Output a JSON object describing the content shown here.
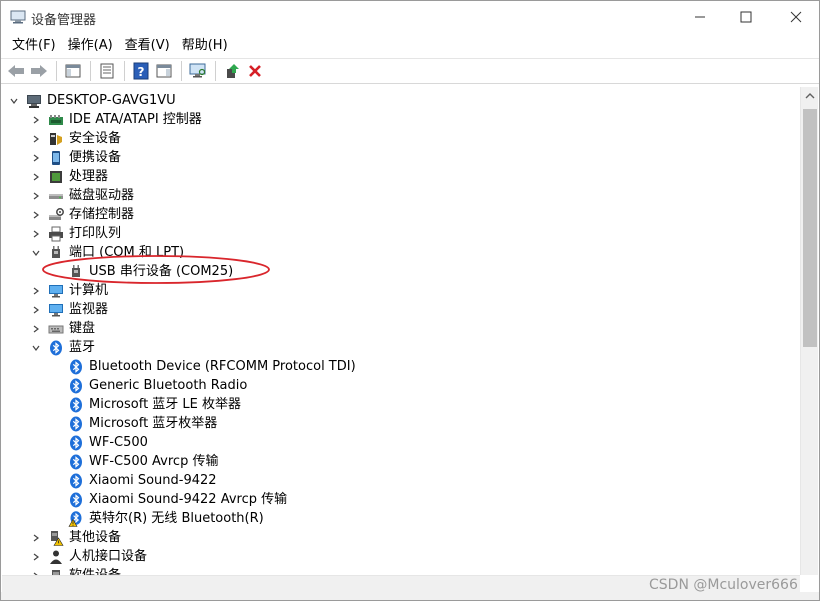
{
  "window": {
    "title": "设备管理器",
    "controls": {
      "minimize": "minimize-icon",
      "maximize": "maximize-icon",
      "close": "close-icon"
    }
  },
  "menu": [
    "文件(F)",
    "操作(A)",
    "查看(V)",
    "帮助(H)"
  ],
  "toolbar": {
    "icons": [
      "back-arrow-icon",
      "forward-arrow-icon",
      "show-hide-console-tree-icon",
      "properties-icon",
      "help-icon",
      "action-pane-icon",
      "scan-hardware-icon",
      "update-driver-icon",
      "uninstall-device-icon"
    ]
  },
  "tree": {
    "root": "DESKTOP-GAVG1VU",
    "categories_top": [
      {
        "label": "IDE ATA/ATAPI 控制器",
        "icon": "ide-controller-icon"
      },
      {
        "label": "安全设备",
        "icon": "security-device-icon"
      },
      {
        "label": "便携设备",
        "icon": "portable-device-icon"
      },
      {
        "label": "处理器",
        "icon": "processor-icon"
      },
      {
        "label": "磁盘驱动器",
        "icon": "disk-drive-icon"
      },
      {
        "label": "存储控制器",
        "icon": "storage-controller-icon"
      },
      {
        "label": "打印队列",
        "icon": "print-queue-icon"
      }
    ],
    "ports": {
      "label": "端口 (COM 和 LPT)",
      "children": [
        "USB 串行设备 (COM25)"
      ]
    },
    "categories_mid": [
      {
        "label": "计算机",
        "icon": "computer-icon"
      },
      {
        "label": "监视器",
        "icon": "monitor-icon"
      },
      {
        "label": "键盘",
        "icon": "keyboard-icon"
      }
    ],
    "bluetooth": {
      "label": "蓝牙",
      "children": [
        {
          "label": "Bluetooth Device (RFCOMM Protocol TDI)",
          "warning": false
        },
        {
          "label": "Generic Bluetooth Radio",
          "warning": false
        },
        {
          "label": "Microsoft 蓝牙 LE 枚举器",
          "warning": false
        },
        {
          "label": "Microsoft 蓝牙枚举器",
          "warning": false
        },
        {
          "label": "WF-C500",
          "warning": false
        },
        {
          "label": "WF-C500 Avrcp 传输",
          "warning": false
        },
        {
          "label": "Xiaomi Sound-9422",
          "warning": false
        },
        {
          "label": "Xiaomi Sound-9422 Avrcp 传输",
          "warning": false
        },
        {
          "label": "英特尔(R) 无线 Bluetooth(R)",
          "warning": true
        }
      ]
    },
    "categories_bottom": [
      {
        "label": "其他设备",
        "icon": "other-device-warning-icon"
      },
      {
        "label": "人机接口设备",
        "icon": "hid-icon"
      },
      {
        "label": "软件设备",
        "icon": "software-device-icon"
      }
    ]
  },
  "watermark": "CSDN @Mculover666",
  "colors": {
    "highlight_ellipse": "#d9262c",
    "bluetooth": "#1e6fd9",
    "window_border": "#9a9a9a"
  }
}
